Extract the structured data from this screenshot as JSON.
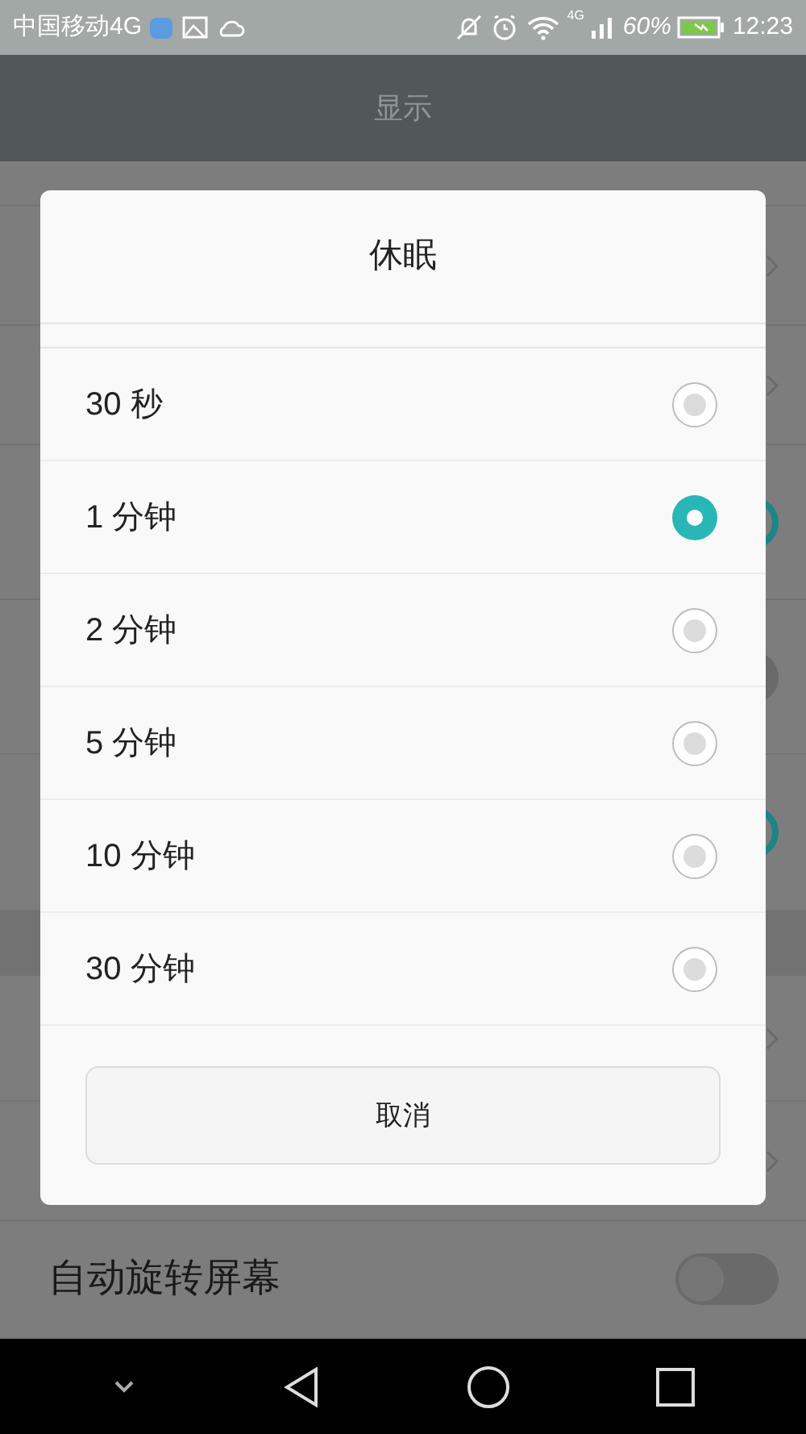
{
  "status_bar": {
    "carrier": "中国移动4G",
    "network_label": "4G",
    "battery_text": "60%",
    "time": "12:23"
  },
  "title_bar": {
    "title": "显示"
  },
  "background_rows": [
    {
      "kind": "blank"
    },
    {
      "kind": "chevron"
    },
    {
      "kind": "chevron"
    },
    {
      "kind": "toggle",
      "on": true
    },
    {
      "kind": "toggle",
      "on": false
    },
    {
      "kind": "toggle",
      "on": true
    },
    {
      "kind": "header"
    },
    {
      "kind": "chevron"
    },
    {
      "kind": "chevron"
    },
    {
      "kind": "toggle",
      "on": false,
      "label": "自动旋转屏幕"
    }
  ],
  "dialog": {
    "title": "休眠",
    "options": [
      {
        "label": "30 秒",
        "selected": false
      },
      {
        "label": "1 分钟",
        "selected": true
      },
      {
        "label": "2 分钟",
        "selected": false
      },
      {
        "label": "5 分钟",
        "selected": false
      },
      {
        "label": "10 分钟",
        "selected": false
      },
      {
        "label": "30 分钟",
        "selected": false
      }
    ],
    "cancel": "取消"
  }
}
